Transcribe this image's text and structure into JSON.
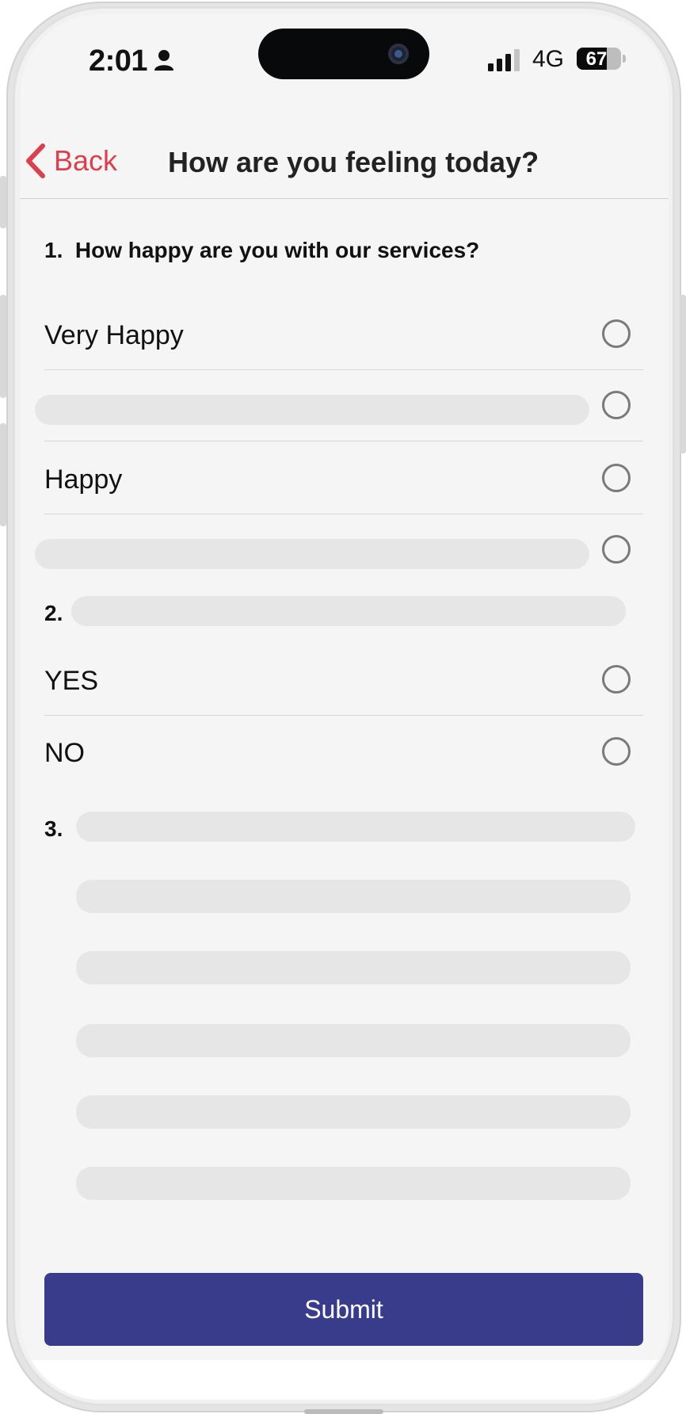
{
  "status_bar": {
    "time": "2:01",
    "network": "4G",
    "battery": "67",
    "battery_level": 0.67
  },
  "nav": {
    "back_label": "Back",
    "title": "How are you feeling today?"
  },
  "questions": [
    {
      "number": "1.",
      "text": "How happy are you with our services?",
      "options": [
        "Very Happy",
        "",
        "Happy",
        ""
      ]
    },
    {
      "number": "2.",
      "text": "",
      "options": [
        "YES",
        "NO"
      ]
    },
    {
      "number": "3.",
      "text": "",
      "options": [
        "",
        "",
        "",
        "",
        ""
      ]
    }
  ],
  "submit_label": "Submit",
  "colors": {
    "accent": "#d9414e",
    "primary_button": "#383c8b",
    "skeleton": "#e6e6e6",
    "radio_border": "#7a7a7a"
  }
}
